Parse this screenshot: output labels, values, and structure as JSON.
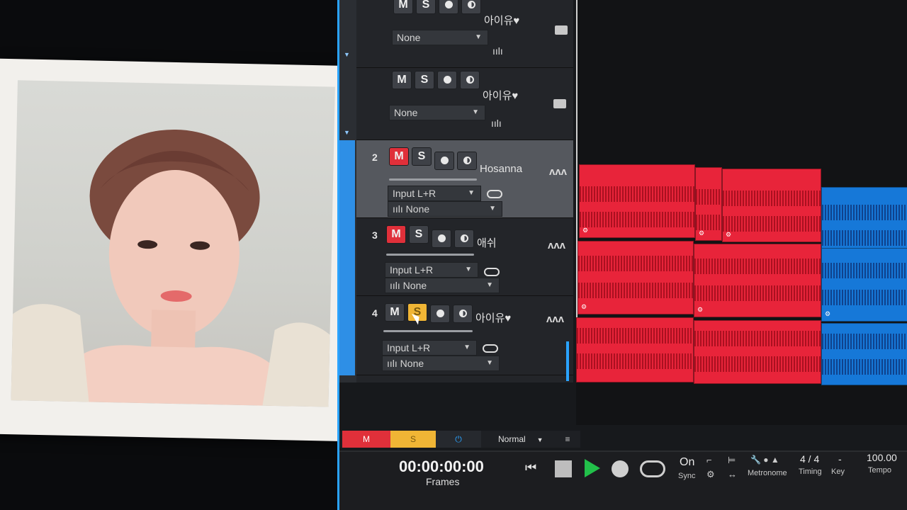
{
  "tracks_top": [
    {
      "label": "아이유♥",
      "input": "None"
    },
    {
      "label": "아이유♥",
      "input": "None"
    }
  ],
  "tracks": [
    {
      "num": "2",
      "name": "Hosanna",
      "input": "Input L+R",
      "output": "None"
    },
    {
      "num": "3",
      "name": "애쉬",
      "input": "Input L+R",
      "output": "None"
    },
    {
      "num": "4",
      "name": "아이유♥",
      "input": "Input L+R",
      "output": "None"
    }
  ],
  "buttons": {
    "mute": "M",
    "solo": "S"
  },
  "status": {
    "mute": "M",
    "solo": "S",
    "mode": "Normal"
  },
  "transport": {
    "time": "00:00:00:00",
    "time_format": "Frames",
    "sync_value": "On",
    "sync_label": "Sync",
    "metronome_label": "Metronome",
    "timing_value": "4 / 4",
    "timing_label": "Timing",
    "key_value": "-",
    "key_label": "Key",
    "tempo_value": "100.00",
    "tempo_label": "Tempo"
  },
  "colors": {
    "mute_on": "#e0303a",
    "solo_on": "#f0b535",
    "accent": "#2aa3ff",
    "clip_red": "#e8243a",
    "clip_blue": "#1678d8"
  }
}
